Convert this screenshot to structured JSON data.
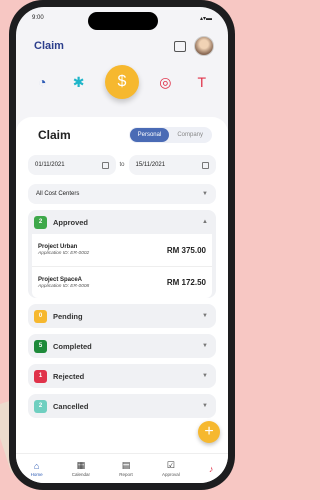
{
  "status": {
    "time": "9:00",
    "right": "▴▾▬"
  },
  "app": {
    "title": "Claim"
  },
  "categories": [
    "speed-icon",
    "palm-icon",
    "money-bag-icon",
    "coin-icon",
    "paint-roller-icon"
  ],
  "card": {
    "title": "Claim",
    "tabs": [
      "Personal",
      "Company"
    ],
    "date_from": "01/11/2021",
    "to_label": "to",
    "date_to": "15/11/2021",
    "cost_center": "All Cost Centers"
  },
  "groups": {
    "approved": {
      "count": "2",
      "label": "Approved",
      "color": "#3ea84a"
    },
    "pending": {
      "count": "0",
      "label": "Pending",
      "color": "#f6b82f"
    },
    "completed": {
      "count": "5",
      "label": "Completed",
      "color": "#1e8a3a"
    },
    "rejected": {
      "count": "1",
      "label": "Rejected",
      "color": "#e0324a"
    },
    "cancelled": {
      "count": "2",
      "label": "Cancelled",
      "color": "#6fcfc0"
    }
  },
  "items": [
    {
      "name": "Project Urban",
      "app_id": "Application ID: ER-0002",
      "amount": "RM 375.00"
    },
    {
      "name": "Project SpaceA",
      "app_id": "Application ID: ER-0008",
      "amount": "RM 172.50"
    }
  ],
  "nav": {
    "home": "Home",
    "calendar": "Calendar",
    "report": "Report",
    "approval": "Approval"
  }
}
